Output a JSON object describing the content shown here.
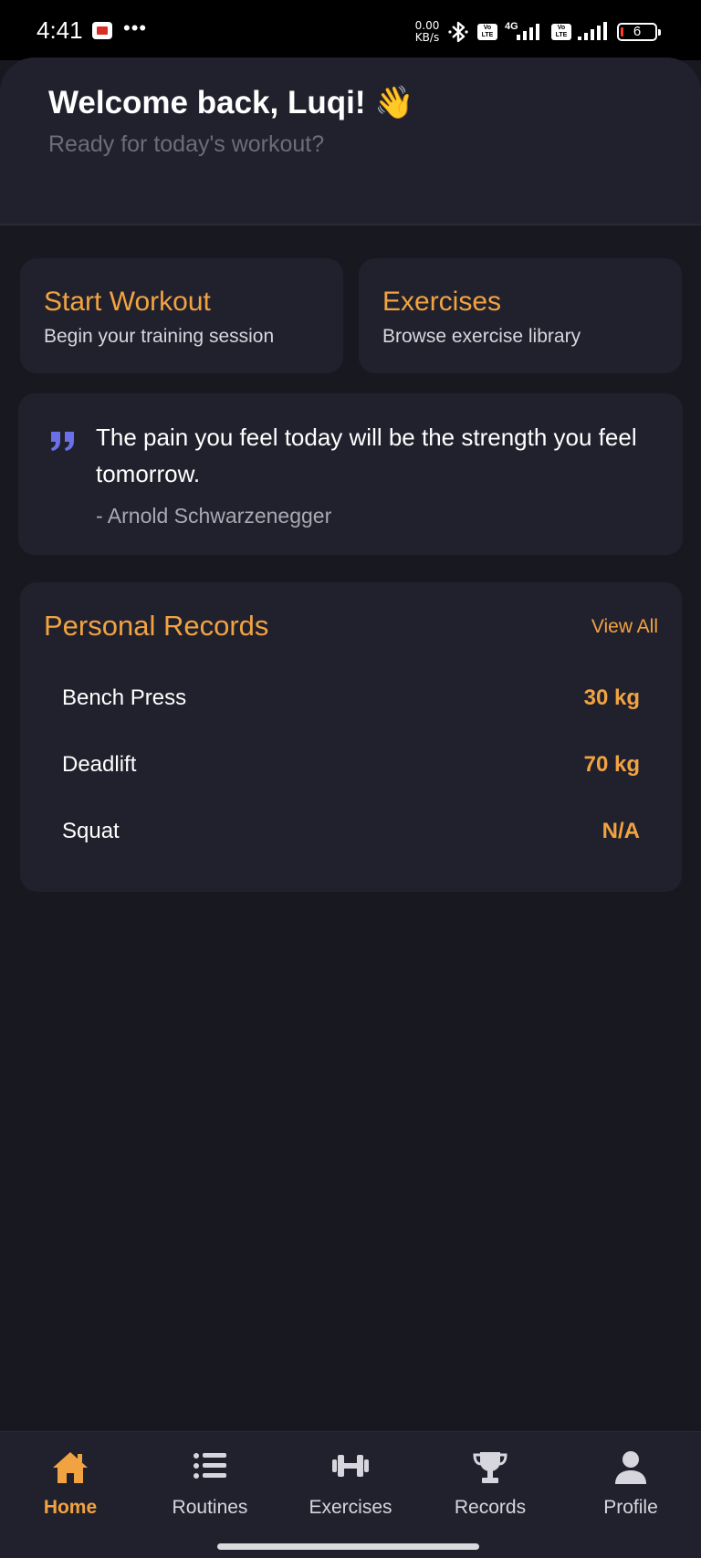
{
  "status_bar": {
    "time": "4:41",
    "net_speed_value": "0.00",
    "net_speed_unit": "KB/s",
    "volte_1": "Vo LTE",
    "network_type": "4G",
    "volte_2": "Vo LTE",
    "battery_level": "6"
  },
  "header": {
    "welcome": "Welcome back, Luqi! 👋",
    "subtitle": "Ready for today's workout?"
  },
  "actions": [
    {
      "title": "Start Workout",
      "description": "Begin your training session"
    },
    {
      "title": "Exercises",
      "description": "Browse exercise library"
    }
  ],
  "quote": {
    "text": "The pain you feel today will be the strength you feel tomorrow.",
    "author": "- Arnold Schwarzenegger",
    "icon": "quote-icon"
  },
  "records": {
    "title": "Personal Records",
    "view_all": "View All",
    "items": [
      {
        "name": "Bench Press",
        "value": "30 kg"
      },
      {
        "name": "Deadlift",
        "value": "70 kg"
      },
      {
        "name": "Squat",
        "value": "N/A"
      }
    ]
  },
  "nav": {
    "active": "Home",
    "items": [
      {
        "label": "Home",
        "icon": "home-icon"
      },
      {
        "label": "Routines",
        "icon": "list-icon"
      },
      {
        "label": "Exercises",
        "icon": "dumbbell-icon"
      },
      {
        "label": "Records",
        "icon": "trophy-icon"
      },
      {
        "label": "Profile",
        "icon": "person-icon"
      }
    ]
  },
  "colors": {
    "accent": "#f2a341",
    "background": "#181821",
    "card": "#21212d",
    "quote_icon": "#6b6fe8"
  }
}
